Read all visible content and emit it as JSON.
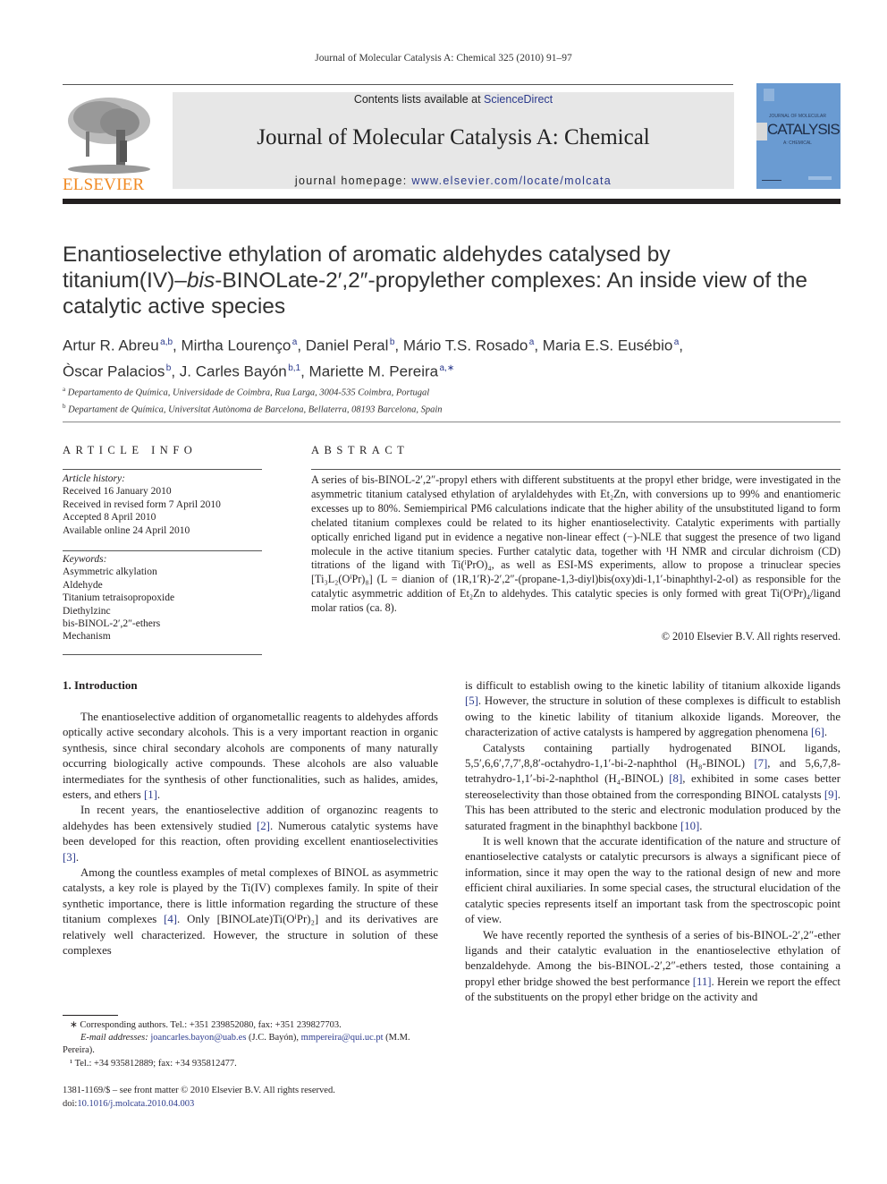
{
  "running_head": "Journal of Molecular Catalysis A: Chemical 325 (2010) 91–97",
  "header": {
    "publisher_logo_text": "ELSEVIER",
    "contents_prefix": "Contents lists available at ",
    "contents_link": "ScienceDirect",
    "journal_title": "Journal of Molecular Catalysis A: Chemical",
    "homepage_prefix": "journal homepage: ",
    "homepage_link": "www.elsevier.com/locate/molcata",
    "cover": {
      "small_title": "JOURNAL OF MOLECULAR",
      "big_title": "CATALYSIS",
      "subtitle": "A: CHEMICAL",
      "color": "#6a9bd2"
    },
    "colors": {
      "elsevier_orange": "#f08a24",
      "link_blue": "#2b3a8c",
      "banner_gray": "#e7e7e7"
    }
  },
  "article": {
    "title_l1": "Enantioselective ethylation of aromatic aldehydes catalysed by",
    "title_l2a": "titanium(IV)–",
    "title_l2b": "bis",
    "title_l2c": "-BINOLate-2′,2″-propylether complexes: An inside view of the",
    "title_l3": "catalytic active species",
    "authors": [
      {
        "name": "Artur R. Abreu",
        "sup": "a,b"
      },
      {
        "name": "Mirtha Lourenço",
        "sup": "a"
      },
      {
        "name": "Daniel Peral",
        "sup": "b"
      },
      {
        "name": "Mário T.S. Rosado",
        "sup": "a"
      },
      {
        "name": "Maria E.S. Eusébio",
        "sup": "a"
      },
      {
        "name": "Òscar Palacios",
        "sup": "b"
      },
      {
        "name": "J. Carles Bayón",
        "sup": "b,1"
      },
      {
        "name": "Mariette M. Pereira",
        "sup": "a,∗"
      }
    ],
    "affiliations": [
      {
        "mark": "a",
        "text": "Departamento de Química, Universidade de Coimbra, Rua Larga, 3004-535 Coimbra, Portugal"
      },
      {
        "mark": "b",
        "text": "Departament de Química, Universitat Autònoma de Barcelona, Bellaterra, 08193 Barcelona, Spain"
      }
    ]
  },
  "article_info": {
    "heading": "ARTICLE INFO",
    "history_label": "Article history:",
    "history": [
      "Received 16 January 2010",
      "Received in revised form 7 April 2010",
      "Accepted 8 April 2010",
      "Available online 24 April 2010"
    ],
    "keywords_label": "Keywords:",
    "keywords": [
      "Asymmetric alkylation",
      "Aldehyde",
      "Titanium tetraisopropoxide",
      "Diethylzinc",
      "bis-BINOL-2′,2″-ethers",
      "Mechanism"
    ]
  },
  "abstract": {
    "heading": "ABSTRACT",
    "text": "A series of bis-BINOL-2′,2″-propyl ethers with different substituents at the propyl ether bridge, were investigated in the asymmetric titanium catalysed ethylation of arylaldehydes with Et₂Zn, with conversions up to 99% and enantiomeric excesses up to 80%. Semiempirical PM6 calculations indicate that the higher ability of the unsubstituted ligand to form chelated titanium complexes could be related to its higher enantioselectivity. Catalytic experiments with partially optically enriched ligand put in evidence a negative non-linear effect (−)-NLE that suggest the presence of two ligand molecule in the active titanium species. Further catalytic data, together with ¹H NMR and circular dichroism (CD) titrations of the ligand with Ti(ⁱPrO)₄, as well as ESI-MS experiments, allow to propose a trinuclear species [Ti₃L₂(OⁱPr)₈] (L = dianion of (1R,1′R)-2′,2″-(propane-1,3-diyl)bis(oxy)di-1,1′-binaphthyl-2-ol) as responsible for the catalytic asymmetric addition of Et₂Zn to aldehydes. This catalytic species is only formed with great Ti(OⁱPr)₄/ligand molar ratios (ca. 8).",
    "copyright": "© 2010 Elsevier B.V. All rights reserved."
  },
  "introduction": {
    "heading": "1.  Introduction",
    "left_paragraphs": [
      {
        "text": "The enantioselective addition of organometallic reagents to aldehydes affords optically active secondary alcohols. This is a very important reaction in organic synthesis, since chiral secondary alcohols are components of many naturally occurring biologically active compounds. These alcohols are also valuable intermediates for the synthesis of other functionalities, such as halides, amides, esters, and ethers ",
        "ref": "[1]",
        "end": "."
      },
      {
        "text": "In recent years, the enantioselective addition of organozinc reagents to aldehydes has been extensively studied ",
        "ref": "[2]",
        "mid": ". Numerous catalytic systems have been developed for this reaction, often providing excellent enantioselectivities ",
        "ref2": "[3]",
        "end": "."
      },
      {
        "text": "Among the countless examples of metal complexes of BINOL as asymmetric catalysts, a key role is played by the Ti(IV) complexes family. In spite of their synthetic importance, there is little information regarding the structure of these titanium complexes ",
        "ref": "[4]",
        "mid": ". Only [BINOLate)Ti(OⁱPr)₂] and its derivatives are relatively well characterized. However, the structure in solution of these complexes",
        "end": ""
      }
    ],
    "right_paragraphs": [
      {
        "text": "is difficult to establish owing to the kinetic lability of titanium alkoxide ligands ",
        "ref": "[5]",
        "mid": ". However, the structure in solution of these complexes is difficult to establish owing to the kinetic lability of titanium alkoxide ligands. Moreover, the characterization of active catalysts is hampered by aggregation phenomena ",
        "ref2": "[6]",
        "end": "."
      },
      {
        "text": "Catalysts containing partially hydrogenated BINOL ligands, 5,5′,6,6′,7,7′,8,8′-octahydro-1,1′-bi-2-naphthol (H₈-BINOL) ",
        "ref": "[7]",
        "mid": ", and 5,6,7,8-tetrahydro-1,1′-bi-2-naphthol (H₄-BINOL) ",
        "ref2": "[8]",
        "mid2": ", exhibited in some cases better stereoselectivity than those obtained from the corresponding BINOL catalysts ",
        "ref3": "[9]",
        "mid3": ". This has been attributed to the steric and electronic modulation produced by the saturated fragment in the binaphthyl backbone ",
        "ref4": "[10]",
        "end": "."
      },
      {
        "text": "It is well known that the accurate identification of the nature and structure of enantioselective catalysts or catalytic precursors is always a significant piece of information, since it may open the way to the rational design of new and more efficient chiral auxiliaries. In some special cases, the structural elucidation of the catalytic species represents itself an important task from the spectroscopic point of view."
      },
      {
        "text": "We have recently reported the synthesis of a series of bis-BINOL-2′,2″-ether ligands and their catalytic evaluation in the enantioselective ethylation of benzaldehyde. Among the bis-BINOL-2′,2″-ethers tested, those containing a propyl ether bridge showed the best performance ",
        "ref": "[11]",
        "mid": ". Herein we report the effect of the substituents on the propyl ether bridge on the activity and",
        "end": ""
      }
    ]
  },
  "footnotes": {
    "corresponding": "∗  Corresponding authors. Tel.: +351 239852080, fax: +351 239827703.",
    "email_label": "E-mail addresses:",
    "email1": "joancarles.bayon@uab.es",
    "email1_who": " (J.C. Bayón), ",
    "email2": "mmpereira@qui.uc.pt",
    "email2_who": " (M.M. Pereira).",
    "note1": "¹  Tel.: +34 935812889; fax: +34 935812477."
  },
  "front_matter": {
    "issn_line": "1381-1169/$ – see front matter © 2010 Elsevier B.V. All rights reserved.",
    "doi_prefix": "doi:",
    "doi": "10.1016/j.molcata.2010.04.003"
  }
}
